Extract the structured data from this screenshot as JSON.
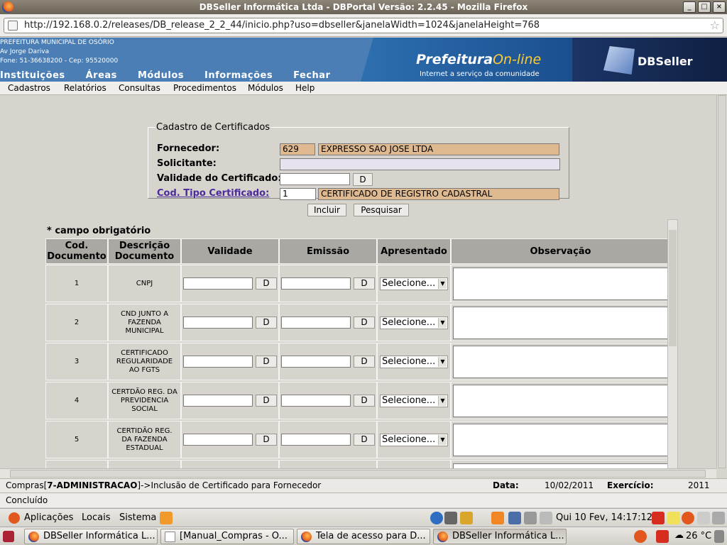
{
  "window": {
    "title": "DBSeller Informática Ltda - DBPortal Versão: 2.2.45 - Mozilla Firefox",
    "buttons": [
      "_",
      "□",
      "×"
    ]
  },
  "browser": {
    "url": "http://192.168.0.2/releases/DB_release_2_2_44/inicio.php?uso=dbseller&janelaWidth=1024&janelaHeight=768",
    "status": "Concluído"
  },
  "banner": {
    "org": "PREFEITURA MUNICIPAL DE OSÓRIO",
    "address": "Av Jorge Dariva",
    "phone": "Fone: 51-36638200  -  Cep: 95520000",
    "menu": [
      "Instituições",
      "Áreas",
      "Módulos",
      "Informações",
      "Fechar"
    ],
    "logo_main": "Prefeitura",
    "logo_online": "On-line",
    "logo_tagline": "Internet a serviço da comunidade",
    "db_logo": "DBSeller"
  },
  "appmenu": [
    "Cadastros",
    "Relatórios",
    "Consultas",
    "Procedimentos",
    "Módulos",
    "Help"
  ],
  "form": {
    "legend": "Cadastro de Certificados",
    "fornecedor_label": "Fornecedor:",
    "fornecedor_code": "629",
    "fornecedor_name": "EXPRESSO SAO JOSE LTDA",
    "solicitante_label": "Solicitante:",
    "validade_label": "Validade do Certificado:",
    "tipo_label": "Cod. Tipo Certificado:",
    "tipo_code": "1",
    "tipo_name": "CERTIFICADO DE REGISTRO CADASTRAL",
    "date_button": "D",
    "incluir": "Incluir",
    "pesquisar": "Pesquisar"
  },
  "grid": {
    "note": "* campo obrigatório",
    "headers": [
      "Cod. Documento",
      "Descrição Documento",
      "Validade",
      "Emissão",
      "Apresentado",
      "Observação"
    ],
    "select_value": "Selecione...",
    "rows": [
      {
        "code": "1",
        "desc": "CNPJ"
      },
      {
        "code": "2",
        "desc": "CND JUNTO A FAZENDA MUNICIPAL"
      },
      {
        "code": "3",
        "desc": "CERTIFICADO REGULARIDADE AO FGTS"
      },
      {
        "code": "4",
        "desc": "CERTDÃO REG. DA PREVIDENCIA SOCIAL"
      },
      {
        "code": "5",
        "desc": "CERTIDÃO REG. DA FAZENDA ESTADUAL"
      }
    ]
  },
  "appstatus": {
    "module": "Compras[",
    "dept": "7-ADMINISTRACAO",
    "action": "]->Inclusão de Certificado para Fornecedor",
    "data_label": "Data:",
    "data_value": "10/02/2011",
    "exercicio_label": "Exercício:",
    "exercicio_value": "2011"
  },
  "panel": {
    "aplicacoes": "Aplicações",
    "locais": "Locais",
    "sistema": "Sistema",
    "clock": "Qui 10 Fev, 14:17:12",
    "weather": "26 °C",
    "tasks": [
      "DBSeller Informática L...",
      "[Manual_Compras - O...",
      "Tela de acesso para D...",
      "DBSeller Informática L..."
    ]
  }
}
